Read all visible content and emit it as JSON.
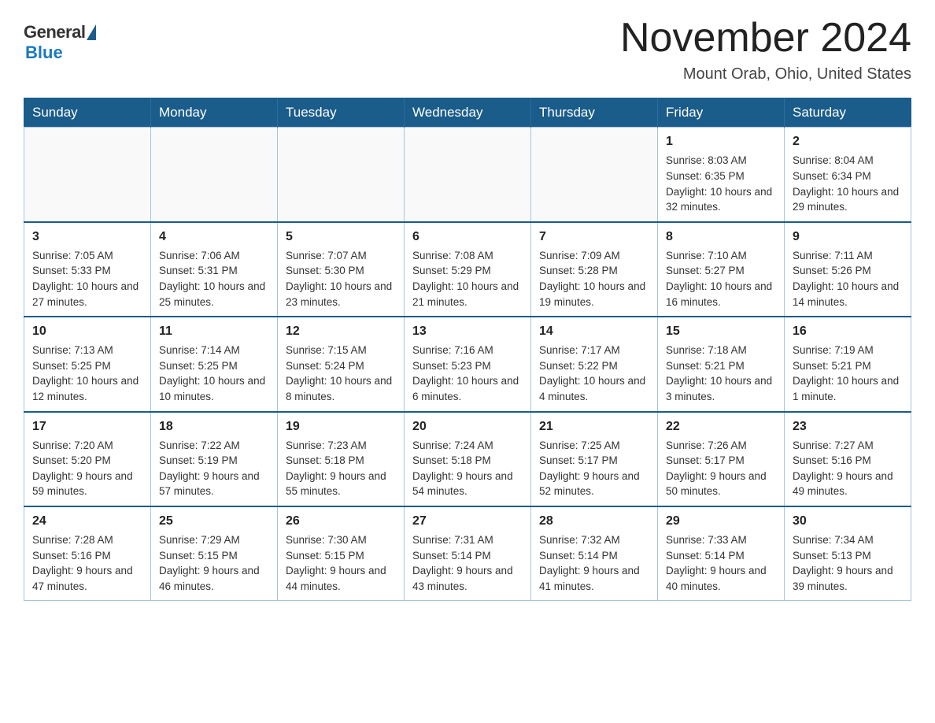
{
  "header": {
    "logo_general": "General",
    "logo_blue": "Blue",
    "month_title": "November 2024",
    "location": "Mount Orab, Ohio, United States"
  },
  "weekdays": [
    "Sunday",
    "Monday",
    "Tuesday",
    "Wednesday",
    "Thursday",
    "Friday",
    "Saturday"
  ],
  "weeks": [
    [
      {
        "day": "",
        "sunrise": "",
        "sunset": "",
        "daylight": "",
        "empty": true
      },
      {
        "day": "",
        "sunrise": "",
        "sunset": "",
        "daylight": "",
        "empty": true
      },
      {
        "day": "",
        "sunrise": "",
        "sunset": "",
        "daylight": "",
        "empty": true
      },
      {
        "day": "",
        "sunrise": "",
        "sunset": "",
        "daylight": "",
        "empty": true
      },
      {
        "day": "",
        "sunrise": "",
        "sunset": "",
        "daylight": "",
        "empty": true
      },
      {
        "day": "1",
        "sunrise": "Sunrise: 8:03 AM",
        "sunset": "Sunset: 6:35 PM",
        "daylight": "Daylight: 10 hours and 32 minutes.",
        "empty": false
      },
      {
        "day": "2",
        "sunrise": "Sunrise: 8:04 AM",
        "sunset": "Sunset: 6:34 PM",
        "daylight": "Daylight: 10 hours and 29 minutes.",
        "empty": false
      }
    ],
    [
      {
        "day": "3",
        "sunrise": "Sunrise: 7:05 AM",
        "sunset": "Sunset: 5:33 PM",
        "daylight": "Daylight: 10 hours and 27 minutes.",
        "empty": false
      },
      {
        "day": "4",
        "sunrise": "Sunrise: 7:06 AM",
        "sunset": "Sunset: 5:31 PM",
        "daylight": "Daylight: 10 hours and 25 minutes.",
        "empty": false
      },
      {
        "day": "5",
        "sunrise": "Sunrise: 7:07 AM",
        "sunset": "Sunset: 5:30 PM",
        "daylight": "Daylight: 10 hours and 23 minutes.",
        "empty": false
      },
      {
        "day": "6",
        "sunrise": "Sunrise: 7:08 AM",
        "sunset": "Sunset: 5:29 PM",
        "daylight": "Daylight: 10 hours and 21 minutes.",
        "empty": false
      },
      {
        "day": "7",
        "sunrise": "Sunrise: 7:09 AM",
        "sunset": "Sunset: 5:28 PM",
        "daylight": "Daylight: 10 hours and 19 minutes.",
        "empty": false
      },
      {
        "day": "8",
        "sunrise": "Sunrise: 7:10 AM",
        "sunset": "Sunset: 5:27 PM",
        "daylight": "Daylight: 10 hours and 16 minutes.",
        "empty": false
      },
      {
        "day": "9",
        "sunrise": "Sunrise: 7:11 AM",
        "sunset": "Sunset: 5:26 PM",
        "daylight": "Daylight: 10 hours and 14 minutes.",
        "empty": false
      }
    ],
    [
      {
        "day": "10",
        "sunrise": "Sunrise: 7:13 AM",
        "sunset": "Sunset: 5:25 PM",
        "daylight": "Daylight: 10 hours and 12 minutes.",
        "empty": false
      },
      {
        "day": "11",
        "sunrise": "Sunrise: 7:14 AM",
        "sunset": "Sunset: 5:25 PM",
        "daylight": "Daylight: 10 hours and 10 minutes.",
        "empty": false
      },
      {
        "day": "12",
        "sunrise": "Sunrise: 7:15 AM",
        "sunset": "Sunset: 5:24 PM",
        "daylight": "Daylight: 10 hours and 8 minutes.",
        "empty": false
      },
      {
        "day": "13",
        "sunrise": "Sunrise: 7:16 AM",
        "sunset": "Sunset: 5:23 PM",
        "daylight": "Daylight: 10 hours and 6 minutes.",
        "empty": false
      },
      {
        "day": "14",
        "sunrise": "Sunrise: 7:17 AM",
        "sunset": "Sunset: 5:22 PM",
        "daylight": "Daylight: 10 hours and 4 minutes.",
        "empty": false
      },
      {
        "day": "15",
        "sunrise": "Sunrise: 7:18 AM",
        "sunset": "Sunset: 5:21 PM",
        "daylight": "Daylight: 10 hours and 3 minutes.",
        "empty": false
      },
      {
        "day": "16",
        "sunrise": "Sunrise: 7:19 AM",
        "sunset": "Sunset: 5:21 PM",
        "daylight": "Daylight: 10 hours and 1 minute.",
        "empty": false
      }
    ],
    [
      {
        "day": "17",
        "sunrise": "Sunrise: 7:20 AM",
        "sunset": "Sunset: 5:20 PM",
        "daylight": "Daylight: 9 hours and 59 minutes.",
        "empty": false
      },
      {
        "day": "18",
        "sunrise": "Sunrise: 7:22 AM",
        "sunset": "Sunset: 5:19 PM",
        "daylight": "Daylight: 9 hours and 57 minutes.",
        "empty": false
      },
      {
        "day": "19",
        "sunrise": "Sunrise: 7:23 AM",
        "sunset": "Sunset: 5:18 PM",
        "daylight": "Daylight: 9 hours and 55 minutes.",
        "empty": false
      },
      {
        "day": "20",
        "sunrise": "Sunrise: 7:24 AM",
        "sunset": "Sunset: 5:18 PM",
        "daylight": "Daylight: 9 hours and 54 minutes.",
        "empty": false
      },
      {
        "day": "21",
        "sunrise": "Sunrise: 7:25 AM",
        "sunset": "Sunset: 5:17 PM",
        "daylight": "Daylight: 9 hours and 52 minutes.",
        "empty": false
      },
      {
        "day": "22",
        "sunrise": "Sunrise: 7:26 AM",
        "sunset": "Sunset: 5:17 PM",
        "daylight": "Daylight: 9 hours and 50 minutes.",
        "empty": false
      },
      {
        "day": "23",
        "sunrise": "Sunrise: 7:27 AM",
        "sunset": "Sunset: 5:16 PM",
        "daylight": "Daylight: 9 hours and 49 minutes.",
        "empty": false
      }
    ],
    [
      {
        "day": "24",
        "sunrise": "Sunrise: 7:28 AM",
        "sunset": "Sunset: 5:16 PM",
        "daylight": "Daylight: 9 hours and 47 minutes.",
        "empty": false
      },
      {
        "day": "25",
        "sunrise": "Sunrise: 7:29 AM",
        "sunset": "Sunset: 5:15 PM",
        "daylight": "Daylight: 9 hours and 46 minutes.",
        "empty": false
      },
      {
        "day": "26",
        "sunrise": "Sunrise: 7:30 AM",
        "sunset": "Sunset: 5:15 PM",
        "daylight": "Daylight: 9 hours and 44 minutes.",
        "empty": false
      },
      {
        "day": "27",
        "sunrise": "Sunrise: 7:31 AM",
        "sunset": "Sunset: 5:14 PM",
        "daylight": "Daylight: 9 hours and 43 minutes.",
        "empty": false
      },
      {
        "day": "28",
        "sunrise": "Sunrise: 7:32 AM",
        "sunset": "Sunset: 5:14 PM",
        "daylight": "Daylight: 9 hours and 41 minutes.",
        "empty": false
      },
      {
        "day": "29",
        "sunrise": "Sunrise: 7:33 AM",
        "sunset": "Sunset: 5:14 PM",
        "daylight": "Daylight: 9 hours and 40 minutes.",
        "empty": false
      },
      {
        "day": "30",
        "sunrise": "Sunrise: 7:34 AM",
        "sunset": "Sunset: 5:13 PM",
        "daylight": "Daylight: 9 hours and 39 minutes.",
        "empty": false
      }
    ]
  ]
}
